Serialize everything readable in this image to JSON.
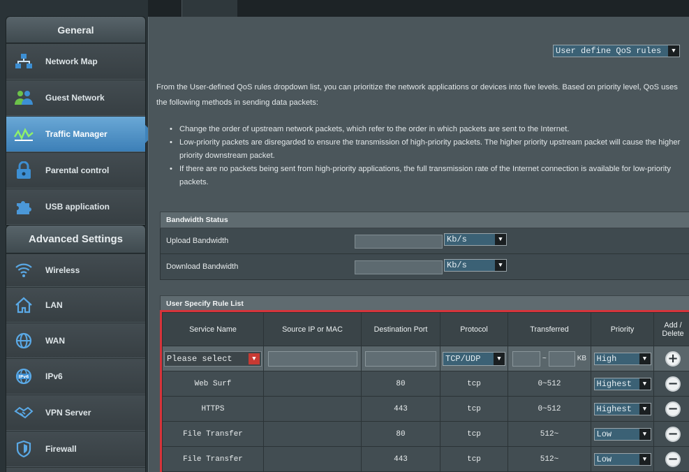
{
  "sidebar": {
    "general_title": "General",
    "general_items": [
      {
        "label": "Network Map",
        "icon": "network-map-icon"
      },
      {
        "label": "Guest Network",
        "icon": "guest-network-icon"
      },
      {
        "label": "Traffic Manager",
        "icon": "traffic-manager-icon"
      },
      {
        "label": "Parental control",
        "icon": "parental-control-icon"
      },
      {
        "label": "USB application",
        "icon": "usb-application-icon"
      }
    ],
    "advanced_title": "Advanced Settings",
    "advanced_items": [
      {
        "label": "Wireless",
        "icon": "wireless-icon"
      },
      {
        "label": "LAN",
        "icon": "lan-icon"
      },
      {
        "label": "WAN",
        "icon": "wan-icon"
      },
      {
        "label": "IPv6",
        "icon": "ipv6-icon"
      },
      {
        "label": "VPN Server",
        "icon": "vpn-server-icon"
      },
      {
        "label": "Firewall",
        "icon": "firewall-icon"
      }
    ],
    "active_item": "Traffic Manager"
  },
  "qos_dropdown": "User define QoS rules",
  "description": "From the User-defined QoS rules dropdown list, you can prioritize the network applications or devices into five levels. Based on priority level, QoS uses the following methods in sending data packets:",
  "bullets": [
    "Change the order of upstream network packets, which refer to the order in which packets are sent to the Internet.",
    "Low-priority packets are disregarded to ensure the transmission of high-priority packets. The higher priority upstream packet will cause the higher priority downstream packet.",
    "If there are no packets being sent from high-priority applications, the full transmission rate of the Internet connection is available for low-priority packets."
  ],
  "bandwidth": {
    "title": "Bandwidth Status",
    "upload_label": "Upload Bandwidth",
    "download_label": "Download Bandwidth",
    "upload_unit": "Kb/s",
    "download_unit": "Kb/s"
  },
  "rule_list": {
    "title": "User Specify Rule List",
    "headers": [
      "Service Name",
      "Source IP or MAC",
      "Destination Port",
      "Protocol",
      "Transferred",
      "Priority",
      "Add / Delete"
    ],
    "input_row": {
      "service": "Please select",
      "protocol": "TCP/UDP",
      "transfer_sep": "~",
      "transfer_unit": "KB",
      "priority": "High"
    },
    "rows": [
      {
        "service": "Web Surf",
        "source": "",
        "port": "80",
        "protocol": "tcp",
        "transferred": "0~512",
        "priority": "Highest"
      },
      {
        "service": "HTTPS",
        "source": "",
        "port": "443",
        "protocol": "tcp",
        "transferred": "0~512",
        "priority": "Highest"
      },
      {
        "service": "File Transfer",
        "source": "",
        "port": "80",
        "protocol": "tcp",
        "transferred": "512~",
        "priority": "Low"
      },
      {
        "service": "File Transfer",
        "source": "",
        "port": "443",
        "protocol": "tcp",
        "transferred": "512~",
        "priority": "Low"
      }
    ]
  },
  "colors": {
    "accent": "#3c7fb7",
    "highlight_border": "#d6343b"
  }
}
